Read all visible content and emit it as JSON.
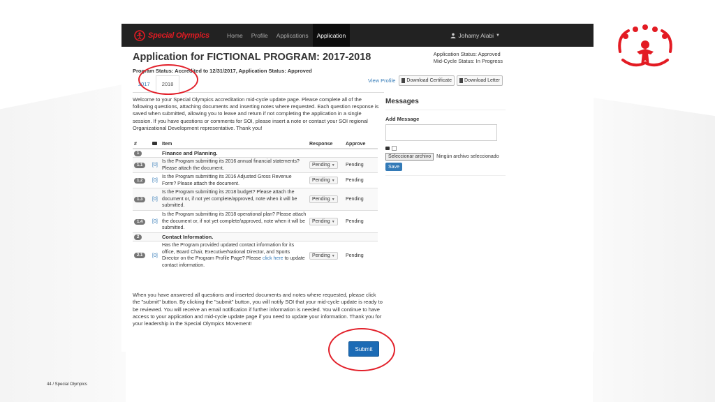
{
  "app": {
    "brand": "Special Olympics",
    "nav": [
      "Home",
      "Profile",
      "Applications",
      "Application"
    ],
    "user": "Johamy Alabi"
  },
  "page": {
    "title": "Application for FICTIONAL PROGRAM: 2017-2018",
    "app_status": "Application Status: Approved",
    "cycle_status": "Mid-Cycle Status: In Progress",
    "program_status": "Program Status: Accredited to 12/31/2017, Application Status: Approved",
    "tabs": [
      "2017",
      "2018"
    ],
    "view_profile": "View Profile",
    "download_certificate": "Download Certificate",
    "download_letter": "Download Letter",
    "intro": "Welcome to your Special Olympics accreditation mid-cycle update page. Please complete all of the following questions, attaching documents and inserting notes where requested. Each question response is saved when submitted, allowing you to leave and return if not completing the application in a single session. If you have questions or comments for SOI, please insert a note or contact your SOI regional Organizational Development representative. Thank you!",
    "outro": "When you have answered all questions and inserted documents and notes where requested, please click the \"submit\" button. By clicking the \"submit\" button, you will notify SOI that your mid-cycle update is ready to be reviewed. You will receive an email notification if further information is needed. You will continue to have access to your application and mid-cycle update page if you need to update your information. Thank you for your leadership in the Special Olympics Movement!",
    "submit": "Submit"
  },
  "table": {
    "headers": {
      "num": "#",
      "item": "Item",
      "response": "Response",
      "approve": "Approve"
    },
    "sections": [
      {
        "num": "1",
        "title": "Finance and Planning."
      },
      {
        "num": "2",
        "title": "Contact Information."
      }
    ],
    "rows": [
      {
        "num": "1.1",
        "count": "[0]",
        "text": "Is the Program submitting its 2016 annual financial statements? Please attach the document.",
        "response": "Pending",
        "approve": "Pending"
      },
      {
        "num": "1.2",
        "count": "[0]",
        "text": "Is the Program submitting its 2016 Adjusted Gross Revenue Form? Please attach the document.",
        "response": "Pending",
        "approve": "Pending"
      },
      {
        "num": "1.3",
        "count": "[0]",
        "text": "Is the Program submitting its 2018 budget? Please attach the document or, if not yet complete/approved, note when it will be submitted.",
        "response": "Pending",
        "approve": "Pending"
      },
      {
        "num": "1.4",
        "count": "[0]",
        "text": "Is the Program submitting its 2018 operational plan? Please attach the document or, if not yet complete/approved, note when it will be submitted.",
        "response": "Pending",
        "approve": "Pending"
      },
      {
        "num": "2.1",
        "count": "[0]",
        "text": "Has the Program provided updated contact information for its office, Board Chair, Executive/National Director, and Sports Director on the Program Profile Page? Please",
        "link": "click here",
        "text_after": " to update contact information.",
        "response": "Pending",
        "approve": "Pending"
      }
    ]
  },
  "messages": {
    "title": "Messages",
    "add_label": "Add Message",
    "file_button": "Seleccionar archivo",
    "file_status": "Ningún archivo seleccionado",
    "save": "Save"
  },
  "footer": "44 /  Special Olympics",
  "colors": {
    "accent": "#e31b23",
    "primary": "#337ab7",
    "navbar": "#222222"
  }
}
